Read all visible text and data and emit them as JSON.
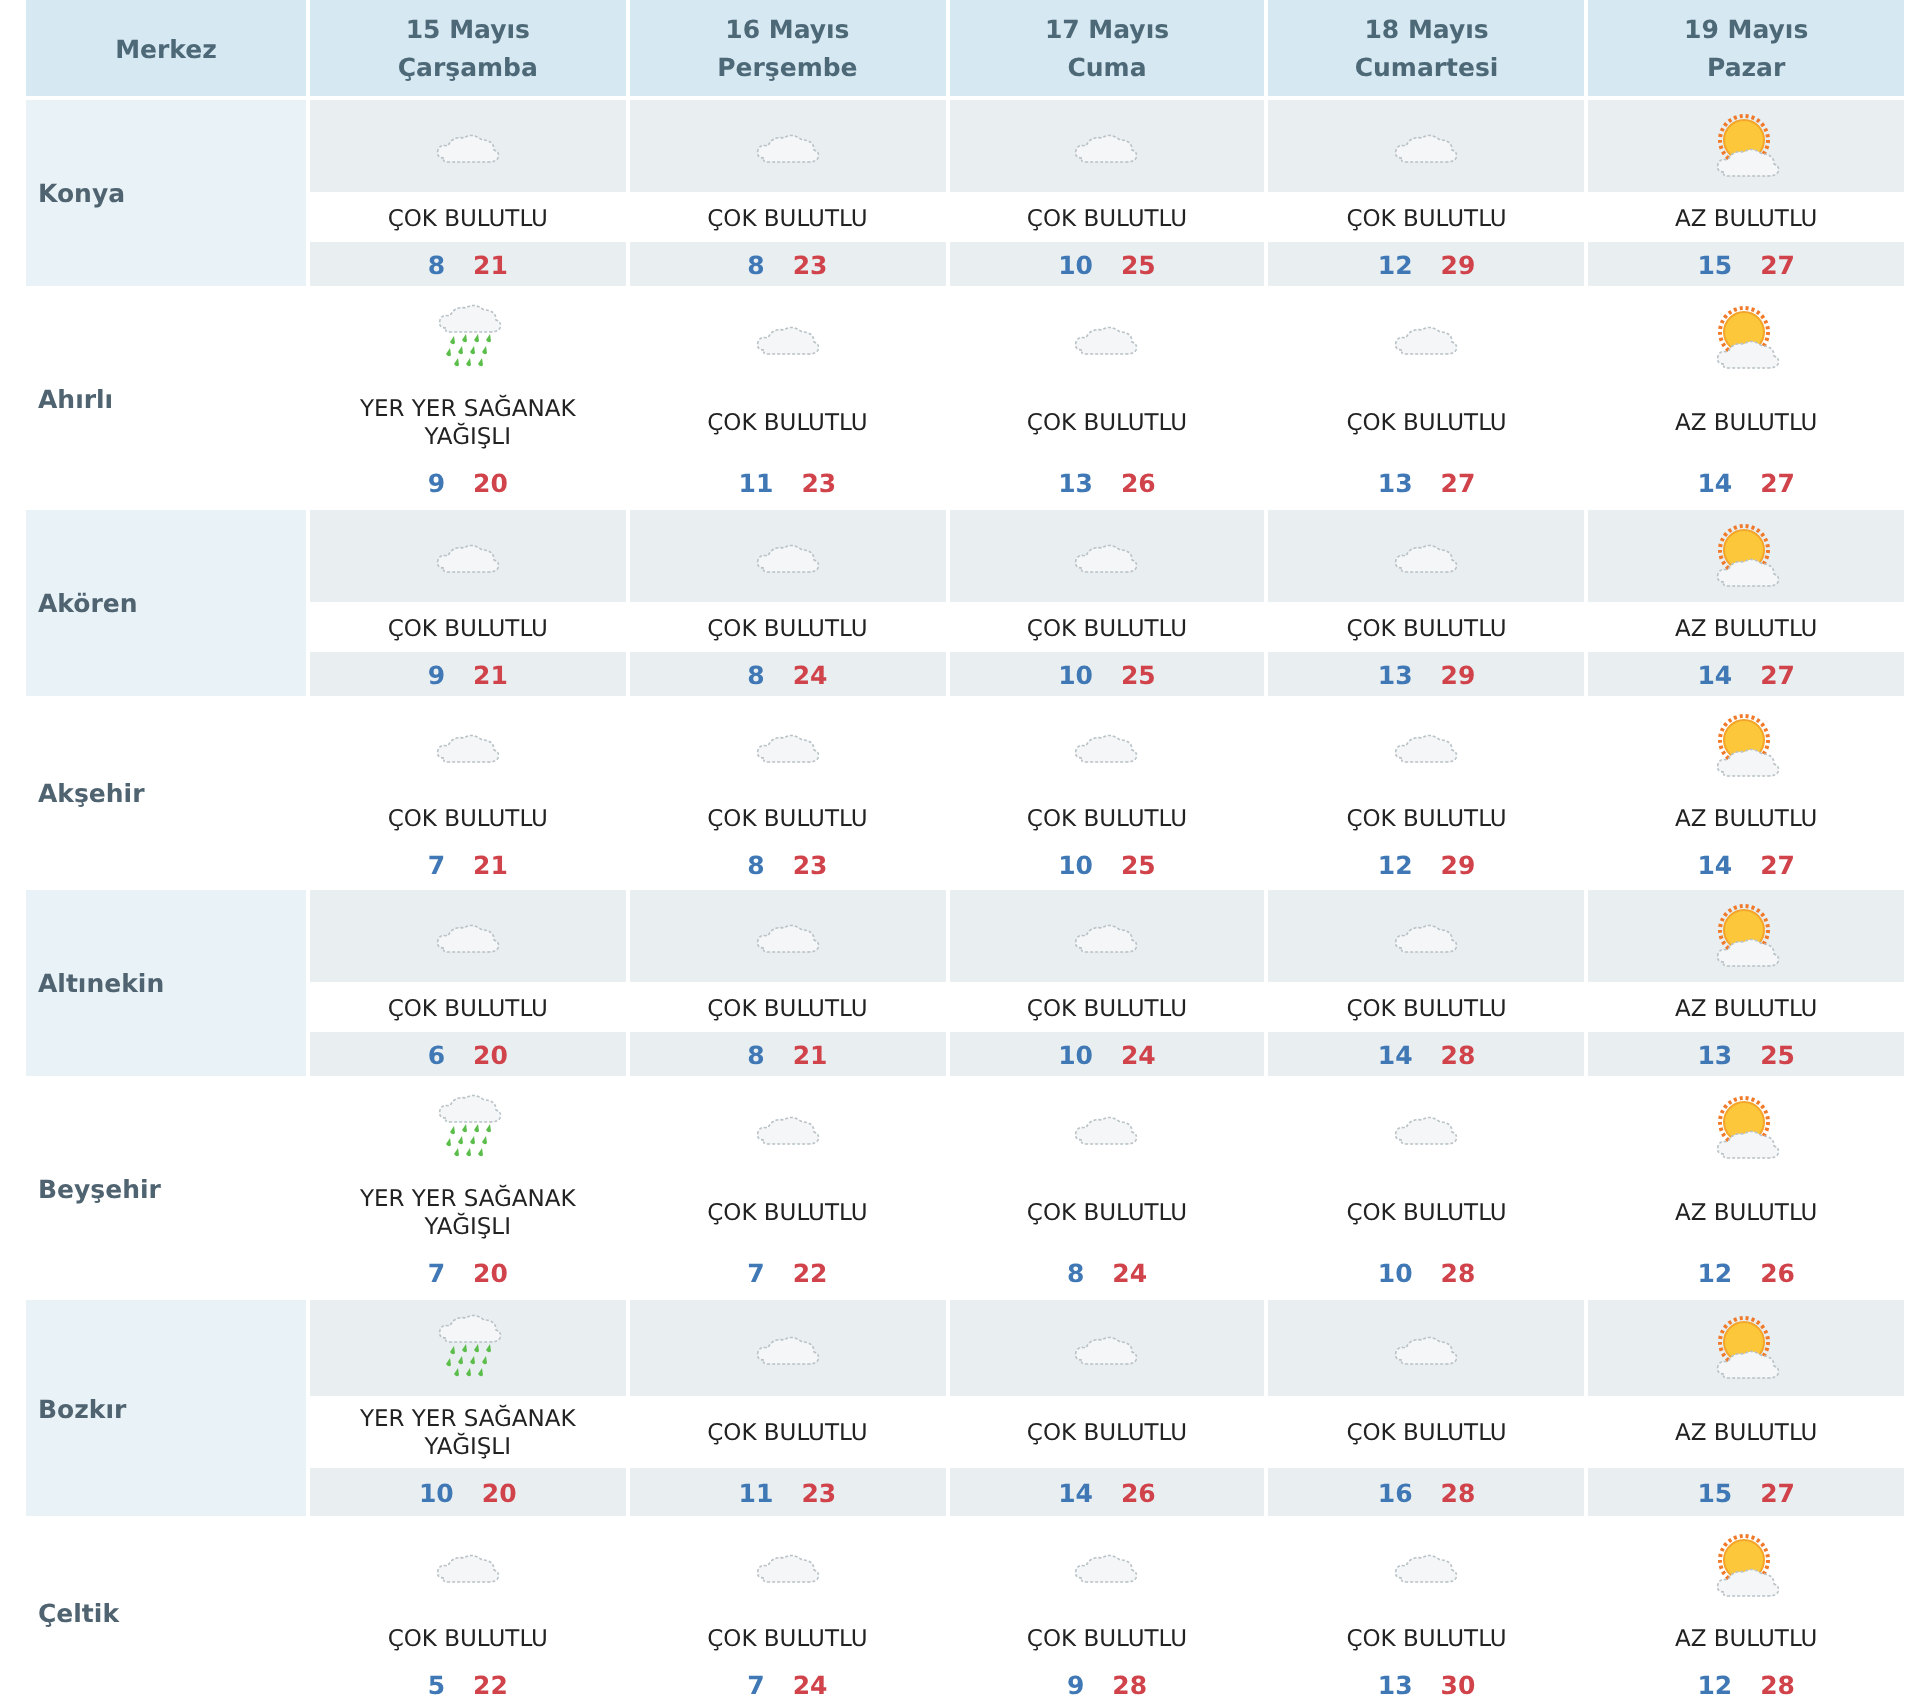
{
  "header": {
    "label": "Merkez",
    "days": [
      {
        "date": "15 Mayıs",
        "weekday": "Çarşamba"
      },
      {
        "date": "16 Mayıs",
        "weekday": "Perşembe"
      },
      {
        "date": "17 Mayıs",
        "weekday": "Cuma"
      },
      {
        "date": "18 Mayıs",
        "weekday": "Cumartesi"
      },
      {
        "date": "19 Mayıs",
        "weekday": "Pazar"
      }
    ]
  },
  "rows": [
    {
      "city": "Konya",
      "days": [
        {
          "kind": "cloudy",
          "condition": "ÇOK BULUTLU",
          "low": "8",
          "high": "21"
        },
        {
          "kind": "cloudy",
          "condition": "ÇOK BULUTLU",
          "low": "8",
          "high": "23"
        },
        {
          "kind": "cloudy",
          "condition": "ÇOK BULUTLU",
          "low": "10",
          "high": "25"
        },
        {
          "kind": "cloudy",
          "condition": "ÇOK BULUTLU",
          "low": "12",
          "high": "29"
        },
        {
          "kind": "partly_sunny",
          "condition": "AZ BULUTLU",
          "low": "15",
          "high": "27"
        }
      ]
    },
    {
      "city": "Ahırlı",
      "days": [
        {
          "kind": "rain",
          "condition": "YER YER SAĞANAK YAĞIŞLI",
          "low": "9",
          "high": "20"
        },
        {
          "kind": "cloudy",
          "condition": "ÇOK BULUTLU",
          "low": "11",
          "high": "23"
        },
        {
          "kind": "cloudy",
          "condition": "ÇOK BULUTLU",
          "low": "13",
          "high": "26"
        },
        {
          "kind": "cloudy",
          "condition": "ÇOK BULUTLU",
          "low": "13",
          "high": "27"
        },
        {
          "kind": "partly_sunny",
          "condition": "AZ BULUTLU",
          "low": "14",
          "high": "27"
        }
      ]
    },
    {
      "city": "Akören",
      "days": [
        {
          "kind": "cloudy",
          "condition": "ÇOK BULUTLU",
          "low": "9",
          "high": "21"
        },
        {
          "kind": "cloudy",
          "condition": "ÇOK BULUTLU",
          "low": "8",
          "high": "24"
        },
        {
          "kind": "cloudy",
          "condition": "ÇOK BULUTLU",
          "low": "10",
          "high": "25"
        },
        {
          "kind": "cloudy",
          "condition": "ÇOK BULUTLU",
          "low": "13",
          "high": "29"
        },
        {
          "kind": "partly_sunny",
          "condition": "AZ BULUTLU",
          "low": "14",
          "high": "27"
        }
      ]
    },
    {
      "city": "Akşehir",
      "days": [
        {
          "kind": "cloudy",
          "condition": "ÇOK BULUTLU",
          "low": "7",
          "high": "21"
        },
        {
          "kind": "cloudy",
          "condition": "ÇOK BULUTLU",
          "low": "8",
          "high": "23"
        },
        {
          "kind": "cloudy",
          "condition": "ÇOK BULUTLU",
          "low": "10",
          "high": "25"
        },
        {
          "kind": "cloudy",
          "condition": "ÇOK BULUTLU",
          "low": "12",
          "high": "29"
        },
        {
          "kind": "partly_sunny",
          "condition": "AZ BULUTLU",
          "low": "14",
          "high": "27"
        }
      ]
    },
    {
      "city": "Altınekin",
      "days": [
        {
          "kind": "cloudy",
          "condition": "ÇOK BULUTLU",
          "low": "6",
          "high": "20"
        },
        {
          "kind": "cloudy",
          "condition": "ÇOK BULUTLU",
          "low": "8",
          "high": "21"
        },
        {
          "kind": "cloudy",
          "condition": "ÇOK BULUTLU",
          "low": "10",
          "high": "24"
        },
        {
          "kind": "cloudy",
          "condition": "ÇOK BULUTLU",
          "low": "14",
          "high": "28"
        },
        {
          "kind": "partly_sunny",
          "condition": "AZ BULUTLU",
          "low": "13",
          "high": "25"
        }
      ]
    },
    {
      "city": "Beyşehir",
      "days": [
        {
          "kind": "rain",
          "condition": "YER YER SAĞANAK YAĞIŞLI",
          "low": "7",
          "high": "20"
        },
        {
          "kind": "cloudy",
          "condition": "ÇOK BULUTLU",
          "low": "7",
          "high": "22"
        },
        {
          "kind": "cloudy",
          "condition": "ÇOK BULUTLU",
          "low": "8",
          "high": "24"
        },
        {
          "kind": "cloudy",
          "condition": "ÇOK BULUTLU",
          "low": "10",
          "high": "28"
        },
        {
          "kind": "partly_sunny",
          "condition": "AZ BULUTLU",
          "low": "12",
          "high": "26"
        }
      ]
    },
    {
      "city": "Bozkır",
      "days": [
        {
          "kind": "rain",
          "condition": "YER YER SAĞANAK YAĞIŞLI",
          "low": "10",
          "high": "20"
        },
        {
          "kind": "cloudy",
          "condition": "ÇOK BULUTLU",
          "low": "11",
          "high": "23"
        },
        {
          "kind": "cloudy",
          "condition": "ÇOK BULUTLU",
          "low": "14",
          "high": "26"
        },
        {
          "kind": "cloudy",
          "condition": "ÇOK BULUTLU",
          "low": "16",
          "high": "28"
        },
        {
          "kind": "partly_sunny",
          "condition": "AZ BULUTLU",
          "low": "15",
          "high": "27"
        }
      ]
    },
    {
      "city": "Çeltik",
      "days": [
        {
          "kind": "cloudy",
          "condition": "ÇOK BULUTLU",
          "low": "5",
          "high": "22"
        },
        {
          "kind": "cloudy",
          "condition": "ÇOK BULUTLU",
          "low": "7",
          "high": "24"
        },
        {
          "kind": "cloudy",
          "condition": "ÇOK BULUTLU",
          "low": "9",
          "high": "28"
        },
        {
          "kind": "cloudy",
          "condition": "ÇOK BULUTLU",
          "low": "13",
          "high": "30"
        },
        {
          "kind": "partly_sunny",
          "condition": "AZ BULUTLU",
          "low": "12",
          "high": "28"
        }
      ]
    }
  ]
}
